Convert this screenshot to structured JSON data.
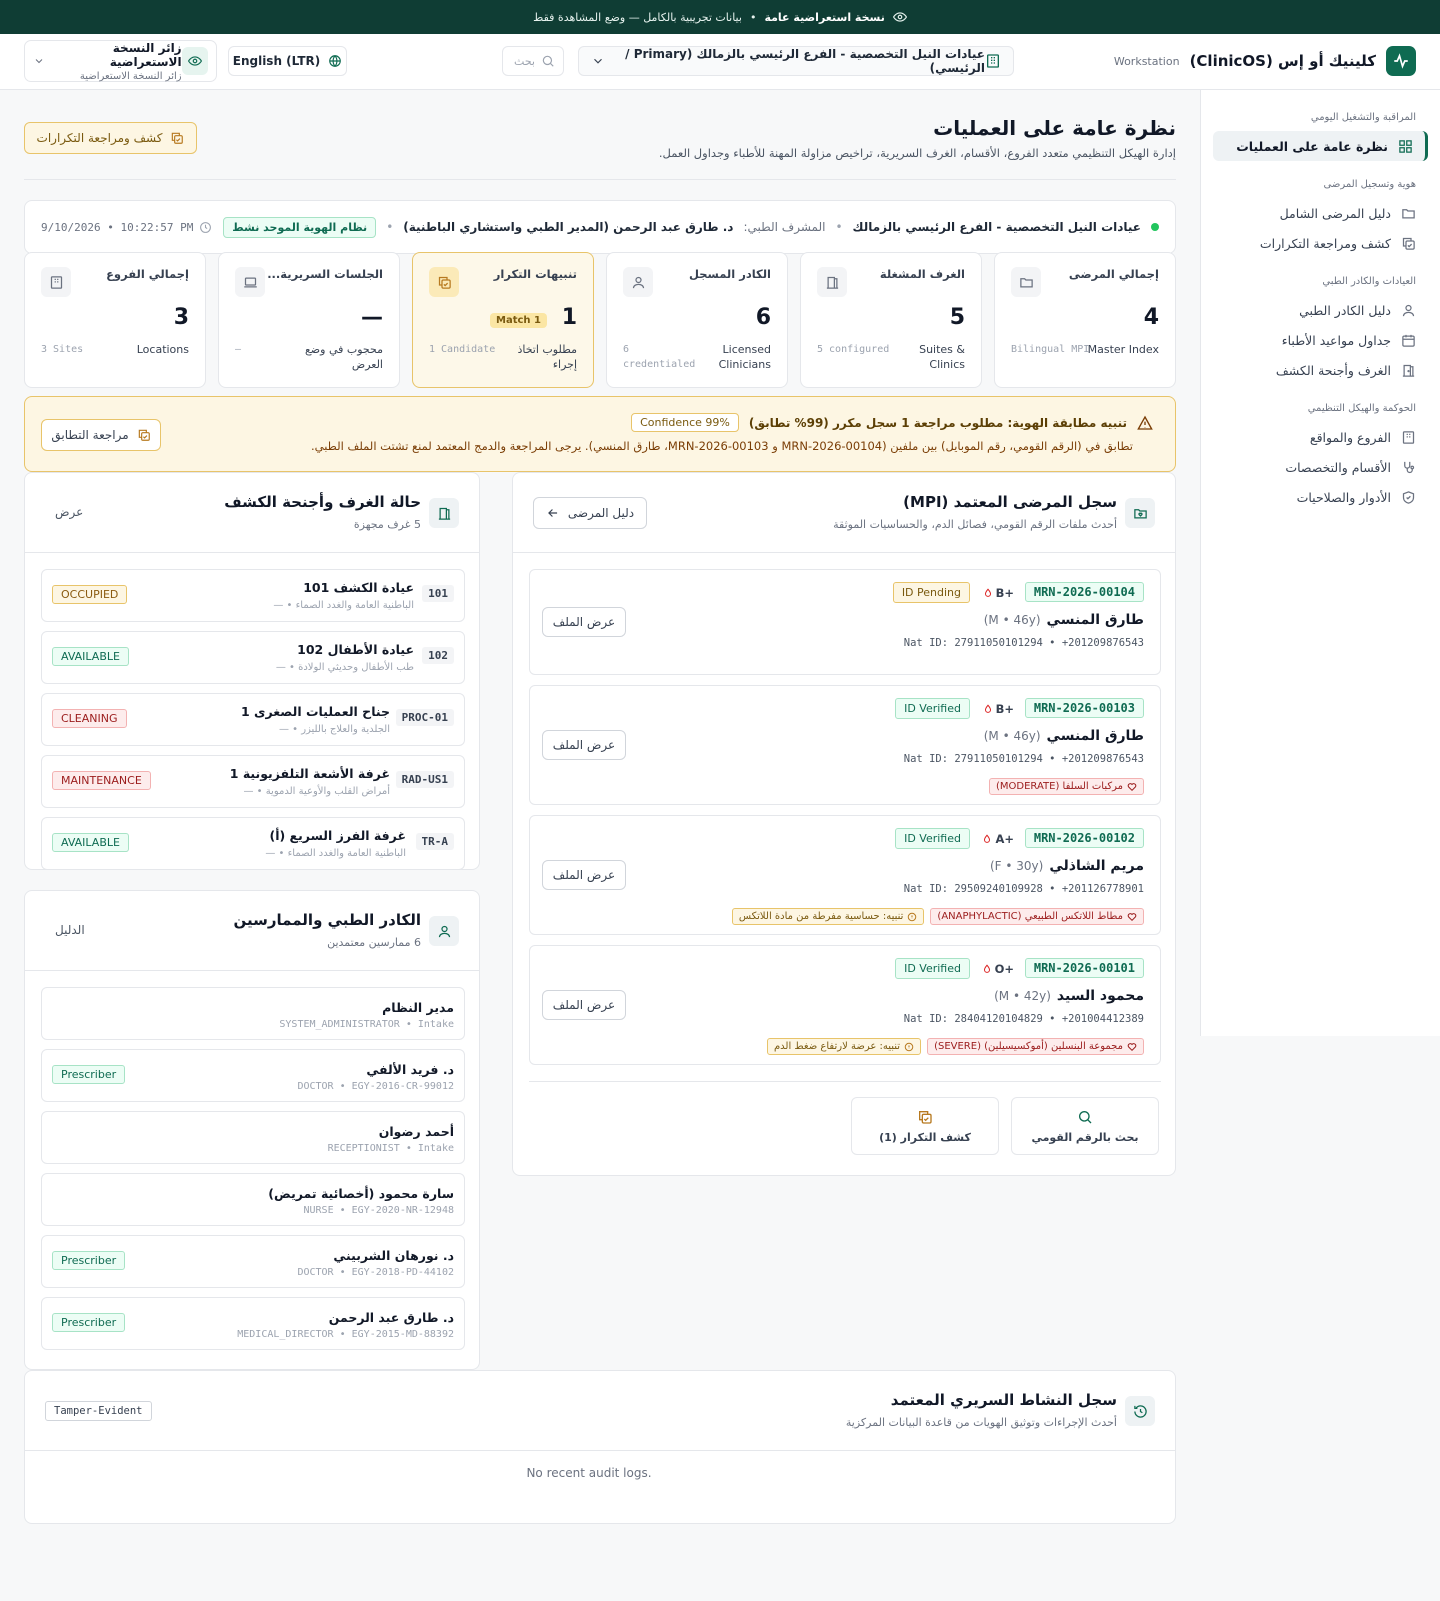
{
  "banner": {
    "title": "نسخة استعراضية عامة",
    "text": "بيانات تجريبية بالكامل — وضع المشاهدة فقط"
  },
  "header": {
    "brand": "كلينيك أو إس (ClinicOS)",
    "workstation": "Workstation",
    "branch": "عيادات النيل التخصصية - الفرع الرئيسي بالزمالك (Primary / الرئيسي)",
    "search_placeholder": "بحث",
    "language": "English (LTR)",
    "user_name": "زائر النسخة الاستعراضية",
    "user_role": "زائر النسخة الاستعراضية"
  },
  "sidebar": {
    "groups": [
      {
        "title": "المراقبة والتشغيل اليومي",
        "items": [
          {
            "label": "نظرة عامة على العمليات",
            "icon": "dashboard-icon"
          }
        ]
      },
      {
        "title": "هوية وتسجيل المرضى",
        "items": [
          {
            "label": "دليل المرضى الشامل",
            "icon": "folder-heart-icon"
          },
          {
            "label": "كشف ومراجعة التكرارات",
            "icon": "copy-check-icon"
          }
        ]
      },
      {
        "title": "العيادات والكادر الطبي",
        "items": [
          {
            "label": "دليل الكادر الطبي",
            "icon": "user-icon"
          },
          {
            "label": "جداول مواعيد الأطباء",
            "icon": "calendar-icon"
          },
          {
            "label": "الغرف وأجنحة الكشف",
            "icon": "door-icon"
          }
        ]
      },
      {
        "title": "الحوكمة والهيكل التنظيمي",
        "items": [
          {
            "label": "الفروع والمواقع",
            "icon": "building-icon"
          },
          {
            "label": "الأقسام والتخصصات",
            "icon": "stethoscope-icon"
          },
          {
            "label": "الأدوار والصلاحيات",
            "icon": "shield-icon"
          }
        ]
      }
    ]
  },
  "page": {
    "title": "نظرة عامة على العمليات",
    "subtitle": "إدارة الهيكل التنظيمي متعدد الفروع، الأقسام، الغرف السريرية، تراخيص مزاولة المهنة للأطباء وجداول العمل.",
    "dup_button": "كشف ومراجعة التكرارات"
  },
  "status": {
    "branch": "عيادات النيل التخصصية - الفرع الرئيسي بالزمالك",
    "supervisor_label": "المشرف الطبي:",
    "supervisor": "د. طارق عبد الرحمن (المدير الطبي واستشاري الباطنية)",
    "mpi_badge": "نظام الهوية الموحد نشط",
    "datetime": "9/10/2026 • 10:22:57 PM"
  },
  "kpis": [
    {
      "title": "إجمالي المرضى",
      "value": "4",
      "label": "Master Index",
      "sub": "Bilingual MPI",
      "icon": "folder-heart-icon"
    },
    {
      "title": "الغرف المشغلة",
      "value": "5",
      "label": "Suites & Clinics",
      "sub": "5 configured",
      "icon": "door-icon"
    },
    {
      "title": "الكادر المسجل",
      "value": "6",
      "label": "Licensed Clinicians",
      "sub": "6 credentialed",
      "icon": "user-icon"
    },
    {
      "title": "تنبيهات التكرار",
      "value": "1",
      "badge": "1 Match",
      "label": "مطلوب اتخاذ إجراء",
      "sub": "1 Candidate",
      "icon": "copy-check-icon"
    },
    {
      "title": "الجلسات السريرية...",
      "value": "—",
      "label": "محجوب في وضع العرض",
      "sub": "—",
      "icon": "laptop-icon"
    },
    {
      "title": "إجمالي الفروع",
      "value": "3",
      "label": "Locations",
      "sub": "3 Sites",
      "icon": "building-icon"
    }
  ],
  "alert": {
    "title": "تنبيه مطابقة الهوية: مطلوب مراجعة 1 سجل مكرر (99% تطابق)",
    "confidence": "Confidence 99%",
    "body": "تطابق في (الرقم القومي، رقم الموبايل) بين ملفين (MRN-2026-00104 و MRN-2026-00103، طارق المنسي). يرجى المراجعة والدمج المعتمد لمنع تشتت الملف الطبي.",
    "button": "مراجعة التطابق"
  },
  "mpi": {
    "title": "سجل المرضى المعتمد (MPI)",
    "subtitle": "أحدث ملفات الرقم القومي، فصائل الدم، والحساسيات الموثقة",
    "back_button": "دليل المرضى",
    "view_label": "عرض الملف",
    "patients": [
      {
        "mrn": "MRN-2026-00104",
        "blood": "B+",
        "status": "ID Pending",
        "status_type": "pending",
        "name": "طارق المنسي",
        "meta": "(M • 46y)",
        "ids": "Nat ID: 27911050101294 • +201209876543",
        "tags": []
      },
      {
        "mrn": "MRN-2026-00103",
        "blood": "B+",
        "status": "ID Verified",
        "status_type": "verified",
        "name": "طارق المنسي",
        "meta": "(M • 46y)",
        "ids": "Nat ID: 27911050101294 • +201209876543",
        "tags": [
          {
            "text": "مركبات السلفا (MODERATE)",
            "type": "red"
          }
        ]
      },
      {
        "mrn": "MRN-2026-00102",
        "blood": "A+",
        "status": "ID Verified",
        "status_type": "verified",
        "name": "مريم الشاذلي",
        "meta": "(F • 30y)",
        "ids": "Nat ID: 29509240109928 • +201126778901",
        "tags": [
          {
            "text": "مطاط اللاتكس الطبيعي (ANAPHYLACTIC)",
            "type": "red"
          },
          {
            "text": "تنبيه: حساسية مفرطة من مادة اللاتكس",
            "type": "amber"
          }
        ]
      },
      {
        "mrn": "MRN-2026-00101",
        "blood": "O+",
        "status": "ID Verified",
        "status_type": "verified",
        "name": "محمود السيد",
        "meta": "(M • 42y)",
        "ids": "Nat ID: 28404120104829 • +201004412389",
        "tags": [
          {
            "text": "مجموعة البنسلين (أموكسيسيلين) (SEVERE)",
            "type": "red"
          },
          {
            "text": "تنبيه: عرضة لارتفاع ضغط الدم",
            "type": "amber"
          }
        ]
      }
    ],
    "actions": {
      "search": "بحث بالرقم القومي",
      "dup": "كشف التكرار (1)"
    }
  },
  "rooms": {
    "title": "حالة الغرف وأجنحة الكشف",
    "subtitle": "5 غرف مجهزة",
    "link": "عرض",
    "items": [
      {
        "code": "101",
        "name": "عيادة الكشف 101",
        "sub": "الباطنية العامة والغدد الصماء • —",
        "status": "OCCUPIED",
        "type": "occupied"
      },
      {
        "code": "102",
        "name": "عيادة الأطفال 102",
        "sub": "طب الأطفال وحديثي الولادة • —",
        "status": "AVAILABLE",
        "type": "available"
      },
      {
        "code": "PROC-01",
        "name": "جناح العمليات الصغرى 1",
        "sub": "الجلدية والعلاج بالليزر • —",
        "status": "CLEANING",
        "type": "cleaning"
      },
      {
        "code": "RAD-US1",
        "name": "غرفة الأشعة التلفزيونية 1",
        "sub": "أمراض القلب والأوعية الدموية • —",
        "status": "MAINTENANCE",
        "type": "maintenance"
      },
      {
        "code": "TR-A",
        "name": "غرفة الفرز السريع (أ)",
        "sub": "الباطنية العامة والغدد الصماء • —",
        "status": "AVAILABLE",
        "type": "available"
      }
    ]
  },
  "staff": {
    "title": "الكادر الطبي والممارسين",
    "subtitle": "6 ممارسين معتمدين",
    "link": "الدليل",
    "items": [
      {
        "name": "مدير النظام",
        "sub": "SYSTEM_ADMINISTRATOR • Intake",
        "role": ""
      },
      {
        "name": "د. فريد الألفي",
        "sub": "DOCTOR • EGY-2016-CR-99012",
        "role": "Prescriber"
      },
      {
        "name": "أحمد رضوان",
        "sub": "RECEPTIONIST • Intake",
        "role": ""
      },
      {
        "name": "سارة محمود (أخصائية تمريض)",
        "sub": "NURSE • EGY-2020-NR-12948",
        "role": ""
      },
      {
        "name": "د. نورهان الشربيني",
        "sub": "DOCTOR • EGY-2018-PD-44102",
        "role": "Prescriber"
      },
      {
        "name": "د. طارق عبد الرحمن",
        "sub": "MEDICAL_DIRECTOR • EGY-2015-MD-88392",
        "role": "Prescriber"
      }
    ]
  },
  "audit": {
    "title": "سجل النشاط السريري المعتمد",
    "subtitle": "أحدث الإجراءات وتوثيق الهويات من قاعدة البيانات المركزية",
    "badge": "Tamper-Evident",
    "empty": "No recent audit logs."
  },
  "colors": {
    "brand": "#0f6b52",
    "banner": "#0f3d34",
    "warning": "#e8c46a",
    "danger": "#9b1c1c"
  }
}
